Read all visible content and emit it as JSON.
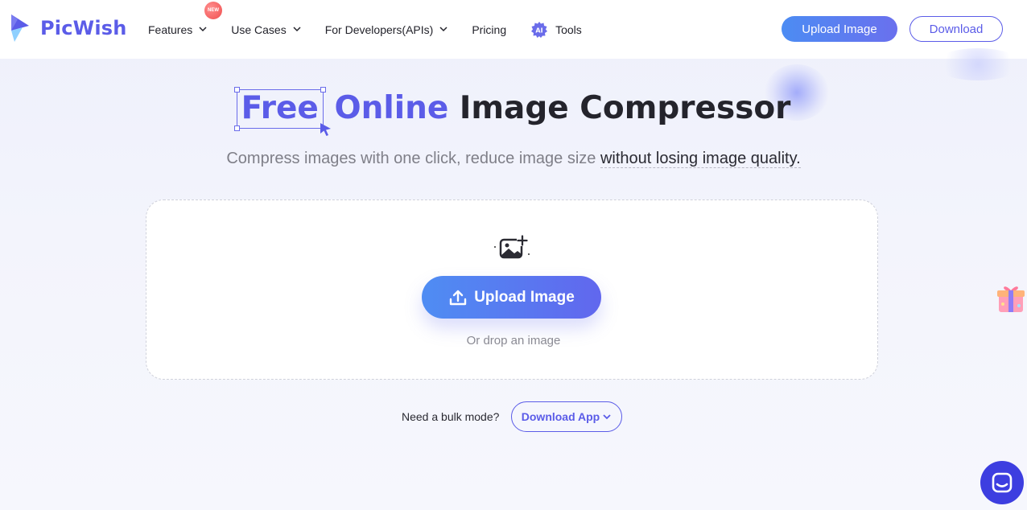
{
  "brand": {
    "name": "PicWish",
    "accent": "#5b5ce8"
  },
  "nav": {
    "items": [
      {
        "label": "Features",
        "badge": "NEW",
        "dropdown": true
      },
      {
        "label": "Use Cases",
        "dropdown": true
      },
      {
        "label": "For Developers(APIs)",
        "dropdown": true
      },
      {
        "label": "Pricing",
        "dropdown": false
      },
      {
        "label": "Tools",
        "icon_label": "AI",
        "dropdown": false
      }
    ],
    "upload_label": "Upload Image",
    "download_label": "Download"
  },
  "hero": {
    "title_free": "Free",
    "title_online": "Online",
    "title_rest": "Image Compressor",
    "subtitle_plain": "Compress images with one click, reduce image size ",
    "subtitle_strong": "without losing image quality."
  },
  "upload": {
    "button_label": "Upload Image",
    "hint": "Or drop an image"
  },
  "bulk": {
    "label": "Need a bulk mode?",
    "button_label": "Download App"
  }
}
